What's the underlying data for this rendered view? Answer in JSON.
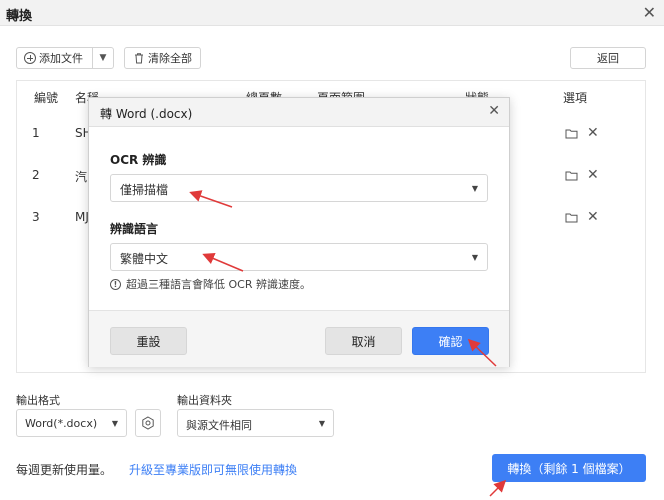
{
  "window": {
    "title": "轉換",
    "close": "✕"
  },
  "toolbar": {
    "add_label": "添加文件",
    "clear_label": "清除全部",
    "back_label": "返回"
  },
  "table": {
    "headers": [
      "編號",
      "名稱",
      "總頁數",
      "頁面範圍",
      "狀態",
      "選項"
    ],
    "rows": [
      {
        "num": "1",
        "name": "SH"
      },
      {
        "num": "2",
        "name": "汽"
      },
      {
        "num": "3",
        "name": "MJ"
      }
    ]
  },
  "modal": {
    "title": "轉 Word (.docx)",
    "ocr_label": "OCR 辨識",
    "ocr_value": "僅掃描檔",
    "lang_label": "辨識語言",
    "lang_value": "繁體中文",
    "note": "超過三種語言會降低 OCR 辨識速度。",
    "reset_label": "重設",
    "cancel_label": "取消",
    "confirm_label": "確認"
  },
  "output": {
    "format_label": "輸出格式",
    "format_value": "Word(*.docx)",
    "folder_label": "輸出資料夾",
    "folder_value": "與源文件相同"
  },
  "footer": {
    "usage_text": "每週更新使用量。",
    "upgrade_link": "升級至專業版即可無限使用轉換",
    "convert_label": "轉換（剩餘 1 個檔案）"
  },
  "colors": {
    "accent": "#3d7ff5",
    "annotation_arrow": "#e03a3a"
  }
}
